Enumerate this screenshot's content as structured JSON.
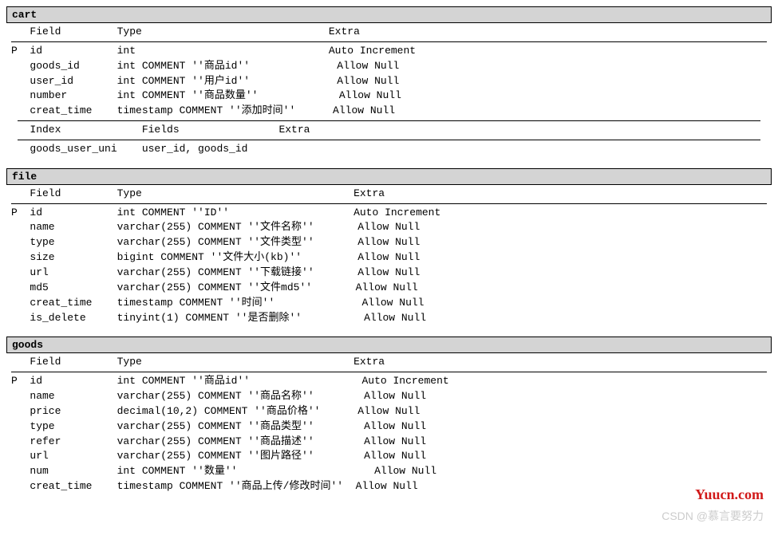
{
  "headers": {
    "field": "Field",
    "type": "Type",
    "extra": "Extra",
    "index": "Index",
    "fields": "Fields"
  },
  "tables": [
    {
      "name": "cart",
      "field_col": 12,
      "type_col": 34,
      "extra_indent": 48,
      "columns": [
        {
          "pk": "P",
          "field": "id",
          "type": "int",
          "extra": "Auto Increment"
        },
        {
          "pk": " ",
          "field": "goods_id",
          "type": "int COMMENT ''商品id''",
          "extra": "  Allow Null"
        },
        {
          "pk": " ",
          "field": "user_id",
          "type": "int COMMENT ''用户id''",
          "extra": "  Allow Null"
        },
        {
          "pk": " ",
          "field": "number",
          "type": "int COMMENT ''商品数量''",
          "extra": "   Allow Null"
        },
        {
          "pk": " ",
          "field": "creat_time",
          "type": "timestamp COMMENT ''添加时间''",
          "extra": "  Allow Null"
        }
      ],
      "indexes": [
        {
          "name": "goods_user_uni",
          "fields": "user_id, goods_id",
          "extra": ""
        }
      ]
    },
    {
      "name": "file",
      "field_col": 12,
      "type_col": 38,
      "extra_indent": 52,
      "columns": [
        {
          "pk": "P",
          "field": "id",
          "type": "int COMMENT ''ID''",
          "extra": "Auto Increment"
        },
        {
          "pk": " ",
          "field": "name",
          "type": "varchar(255) COMMENT ''文件名称''",
          "extra": "  Allow Null"
        },
        {
          "pk": " ",
          "field": "type",
          "type": "varchar(255) COMMENT ''文件类型''",
          "extra": "  Allow Null"
        },
        {
          "pk": " ",
          "field": "size",
          "type": "bigint COMMENT ''文件大小(kb)''",
          "extra": "  Allow Null"
        },
        {
          "pk": " ",
          "field": "url",
          "type": "varchar(255) COMMENT ''下载链接''",
          "extra": "  Allow Null"
        },
        {
          "pk": " ",
          "field": "md5",
          "type": "varchar(255) COMMENT ''文件md5''",
          "extra": " Allow Null"
        },
        {
          "pk": " ",
          "field": "creat_time",
          "type": "timestamp COMMENT ''时间''",
          "extra": "  Allow Null"
        },
        {
          "pk": " ",
          "field": "is_delete",
          "type": "tinyint(1) COMMENT ''是否删除''",
          "extra": "   Allow Null"
        }
      ]
    },
    {
      "name": "goods",
      "field_col": 12,
      "type_col": 38,
      "extra_indent": 52,
      "columns": [
        {
          "pk": "P",
          "field": "id",
          "type": "int COMMENT ''商品id''",
          "extra": "  Auto Increment"
        },
        {
          "pk": " ",
          "field": "name",
          "type": "varchar(255) COMMENT ''商品名称''",
          "extra": "   Allow Null"
        },
        {
          "pk": " ",
          "field": "price",
          "type": "decimal(10,2) COMMENT ''商品价格''",
          "extra": "  Allow Null"
        },
        {
          "pk": " ",
          "field": "type",
          "type": "varchar(255) COMMENT ''商品类型''",
          "extra": "   Allow Null"
        },
        {
          "pk": " ",
          "field": "refer",
          "type": "varchar(255) COMMENT ''商品描述''",
          "extra": "   Allow Null"
        },
        {
          "pk": " ",
          "field": "url",
          "type": "varchar(255) COMMENT ''图片路径''",
          "extra": "   Allow Null"
        },
        {
          "pk": " ",
          "field": "num",
          "type": "int COMMENT ''数量''",
          "extra": "    Allow Null"
        },
        {
          "pk": " ",
          "field": "creat_time",
          "type": "timestamp COMMENT ''商品上传/修改时间''",
          "extra": "  Allow Null"
        }
      ]
    }
  ],
  "watermarks": {
    "top": "Yuucn.com",
    "bottom": "CSDN @慕言要努力"
  }
}
